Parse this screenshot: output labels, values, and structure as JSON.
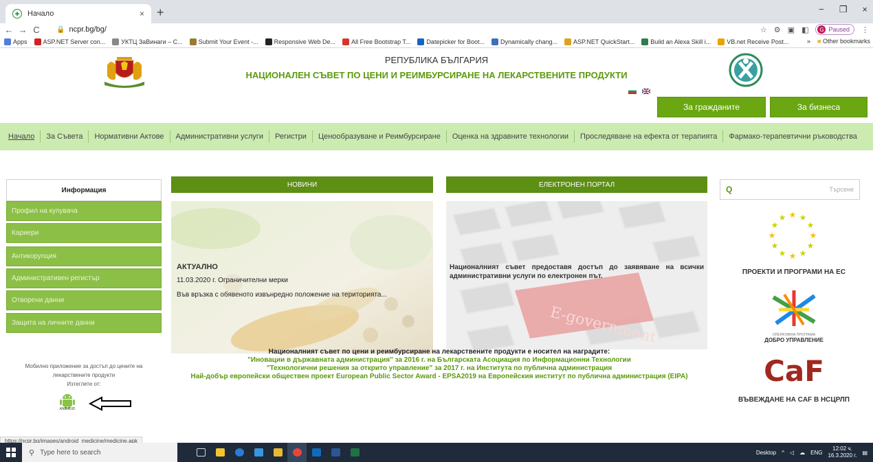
{
  "browser": {
    "tab_title": "Начало",
    "favicon": "ncpr-logo-icon",
    "new_tab": "+",
    "tab_close": "×",
    "window_controls": [
      "−",
      "❐",
      "×"
    ],
    "url": "ncpr.bg/bg/",
    "paused_label": "Paused",
    "profile_initial": "G",
    "bookmarks": [
      {
        "label": "Apps",
        "color": "#4f7fd9"
      },
      {
        "label": "ASP.NET Server con...",
        "color": "#d32020"
      },
      {
        "label": "УКТЦ ЗаВинаги – С...",
        "color": "#888888"
      },
      {
        "label": "Submit Your Event -...",
        "color": "#9a7b2f"
      },
      {
        "label": "Responsive Web De...",
        "color": "#222222"
      },
      {
        "label": "All Free Bootstrap T...",
        "color": "#d9342b"
      },
      {
        "label": "Datepicker for Boot...",
        "color": "#1565c0"
      },
      {
        "label": "Dynamically chang...",
        "color": "#3f6fb5"
      },
      {
        "label": "ASP.NET QuickStart...",
        "color": "#e0a020"
      },
      {
        "label": "Build an Alexa Skill i...",
        "color": "#2d7d4f"
      },
      {
        "label": "VB.net Receive Post...",
        "color": "#e8a400"
      }
    ],
    "more_bookmarks": "»",
    "other_bookmarks": "Other bookmarks",
    "status_url": "https://ncpr.bg/images/android_medicine/medicine.apk"
  },
  "header": {
    "republic": "РЕПУБЛИКА БЪЛГАРИЯ",
    "council": "НАЦИОНАЛЕН СЪВЕТ ПО ЦЕНИ И РЕИМБУРСИРАНЕ НА ЛЕКАРСТВЕНИТЕ ПРОДУКТИ",
    "citizens_btn": "За гражданите",
    "business_btn": "За бизнеса"
  },
  "nav": [
    "Начало",
    "За Съвета",
    "Нормативни Актове",
    "Административни услуги",
    "Регистри",
    "Ценообразуване и Реимбурсиране",
    "Оценка на здравните технологии",
    "Проследяване на ефекта от терапията",
    "Фармако-терапевтични ръководства"
  ],
  "sidebar": {
    "heading": "Информация",
    "items": [
      "Профил на купувача",
      "Кариери",
      "Антикорупция",
      "Административен регистър",
      "Отворени данни",
      "Защита на личните данни"
    ],
    "mobile_text": [
      "Мобилно приложение за достъп до цените на",
      "лекарствените продукти",
      "Изтеглете от:"
    ],
    "android_label": "ANDROID"
  },
  "news": {
    "heading": "НОВИНИ",
    "tag": "АКТУАЛНО",
    "date_title": "11.03.2020 г. Ограничителни мерки",
    "desc": "Във връзка с обявеното извънредно положение на територията..."
  },
  "portal": {
    "heading": "ЕЛЕКТРОНЕН ПОРТАЛ",
    "text": "Националният съвет предоставя достъп до заявяване на всички административни услуги по електронен път.",
    "key_text": "E-government"
  },
  "awards": [
    "Националният съвет по цени и реимбурсиране на лекарствените продукти е носител на наградите:",
    "\"Иновации в държавната администрация\" за 2016 г. на Българската Асоциация по Информационни Технологии",
    "\"Технологични решения за открито управление\" за 2017 г. на Института по публична администрация",
    "Най-добър европейски обществен проект European Public Sector Award - EPSA2019 на Европейския институт по публична администрация (EIPA)"
  ],
  "right": {
    "search_placeholder": "Търсене",
    "eu_label": "ПРОЕКТИ И ПРОГРАМИ НА ЕС",
    "dobro_label": "ДОБРО УПРАВЛЕНИЕ",
    "dobro_small": "ОПЕРАТИВНА ПРОГРАМА",
    "caf_logo": "CaF",
    "caf_label": "ВЪВЕЖДАНЕ НА CAF В НСЦРЛП"
  },
  "taskbar": {
    "search_placeholder": "Type here to search",
    "desktop": "Desktop",
    "lang": "ENG",
    "time": "12:02 ч.",
    "date": "16.3.2020 г."
  },
  "colors": {
    "brand_green": "#6aa712",
    "dark_green": "#5c8f14",
    "nav_bg": "#ccebb0",
    "sidebar_green": "#8cbf46"
  }
}
